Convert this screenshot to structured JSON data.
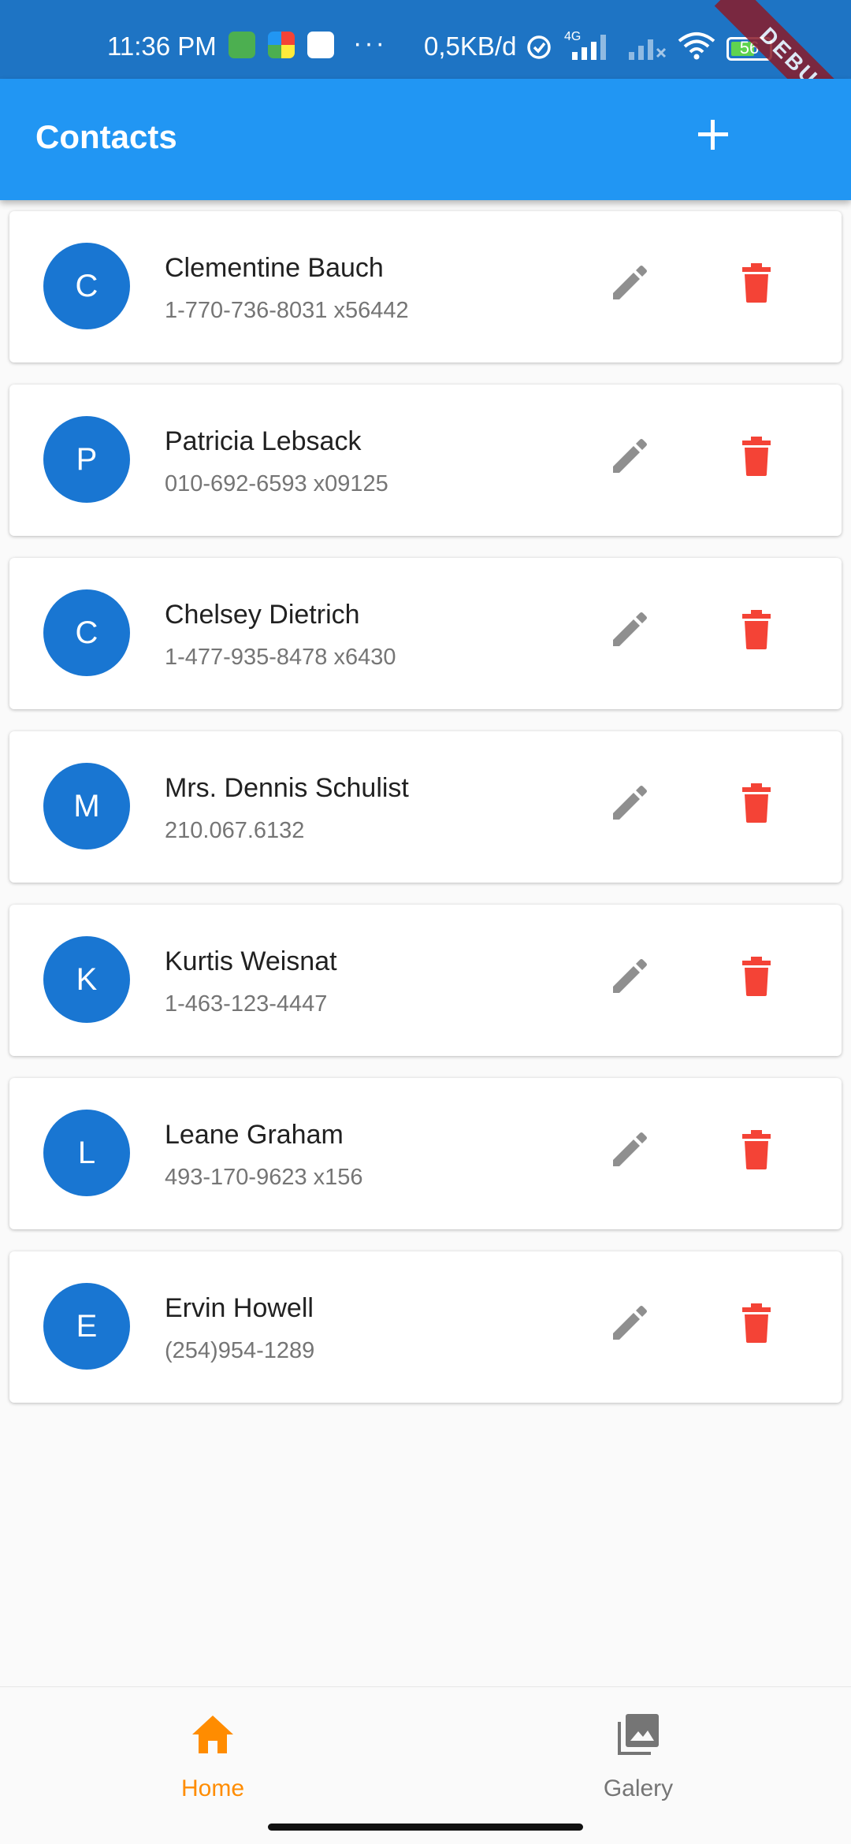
{
  "status_bar": {
    "time": "11:36 PM",
    "more": "···",
    "net_speed": "0,5KB/d",
    "network": "4G",
    "battery": "56",
    "battery_level": 0.56,
    "debug_banner": "DEBUG"
  },
  "app_bar": {
    "title": "Contacts",
    "add_icon": "plus-icon"
  },
  "contacts": [
    {
      "initial": "C",
      "name": "Clementine Bauch",
      "phone": "1-770-736-8031 x56442"
    },
    {
      "initial": "P",
      "name": "Patricia Lebsack",
      "phone": "010-692-6593 x09125"
    },
    {
      "initial": "C",
      "name": "Chelsey Dietrich",
      "phone": "1-477-935-8478 x6430"
    },
    {
      "initial": "M",
      "name": "Mrs. Dennis Schulist",
      "phone": "210.067.6132"
    },
    {
      "initial": "K",
      "name": "Kurtis Weisnat",
      "phone": "1-463-123-4447"
    },
    {
      "initial": "L",
      "name": "Leane Graham",
      "phone": "493-170-9623 x156"
    },
    {
      "initial": "E",
      "name": "Ervin Howell",
      "phone": "(254)954-1289"
    }
  ],
  "bottom_nav": {
    "home_label": "Home",
    "gallery_label": "Galery",
    "active": "Home"
  },
  "colors": {
    "app_bar": "#2196f3",
    "status_bar": "#1e74c4",
    "avatar": "#1976d2",
    "edit_icon": "#8f8f8f",
    "delete_icon": "#f44336",
    "nav_active": "#ff8c00",
    "nav_inactive": "#757575"
  }
}
